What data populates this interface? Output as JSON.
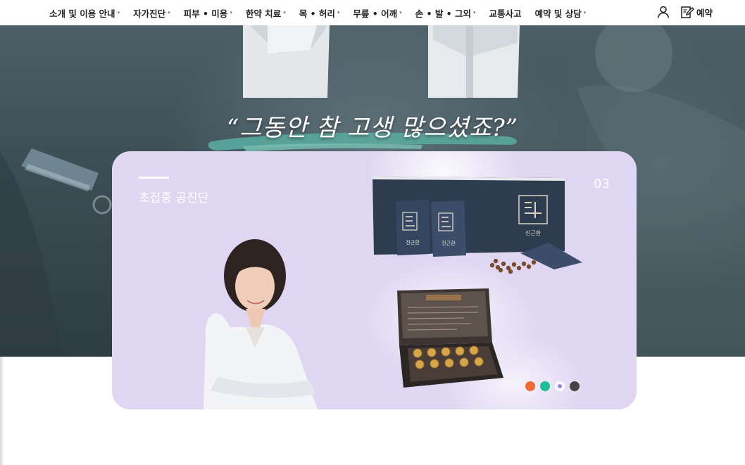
{
  "nav": {
    "menu": [
      {
        "label": "소개 및 이용 안내",
        "dropdown": true
      },
      {
        "label": "자가진단",
        "dropdown": true
      },
      {
        "label": "피부 • 미용",
        "dropdown": true
      },
      {
        "label": "한약 치료",
        "dropdown": true
      },
      {
        "label": "목 • 허리",
        "dropdown": true
      },
      {
        "label": "무릎 • 어깨",
        "dropdown": true
      },
      {
        "label": "손 • 발 • 그외",
        "dropdown": true
      },
      {
        "label": "교통사고",
        "dropdown": false
      },
      {
        "label": "예약 및 상담",
        "dropdown": true
      }
    ],
    "caret": "▾",
    "user_icon": "user-icon",
    "reserve": {
      "icon": "edit-icon",
      "label": "예약"
    }
  },
  "hero": {
    "tagline": "“그동안 참 고생 많으셨죠?”"
  },
  "card": {
    "title": "초집중 공진단",
    "number": "03",
    "background": "#ded6f2",
    "products": {
      "box_brand": "진근환",
      "pouch_label": "진근환"
    },
    "dots": [
      {
        "color": "#f26b35",
        "active": false
      },
      {
        "color": "#1fbf96",
        "active": false
      },
      {
        "color": "#9a7ae6",
        "active": true
      },
      {
        "color": "#444444",
        "active": false
      }
    ]
  }
}
